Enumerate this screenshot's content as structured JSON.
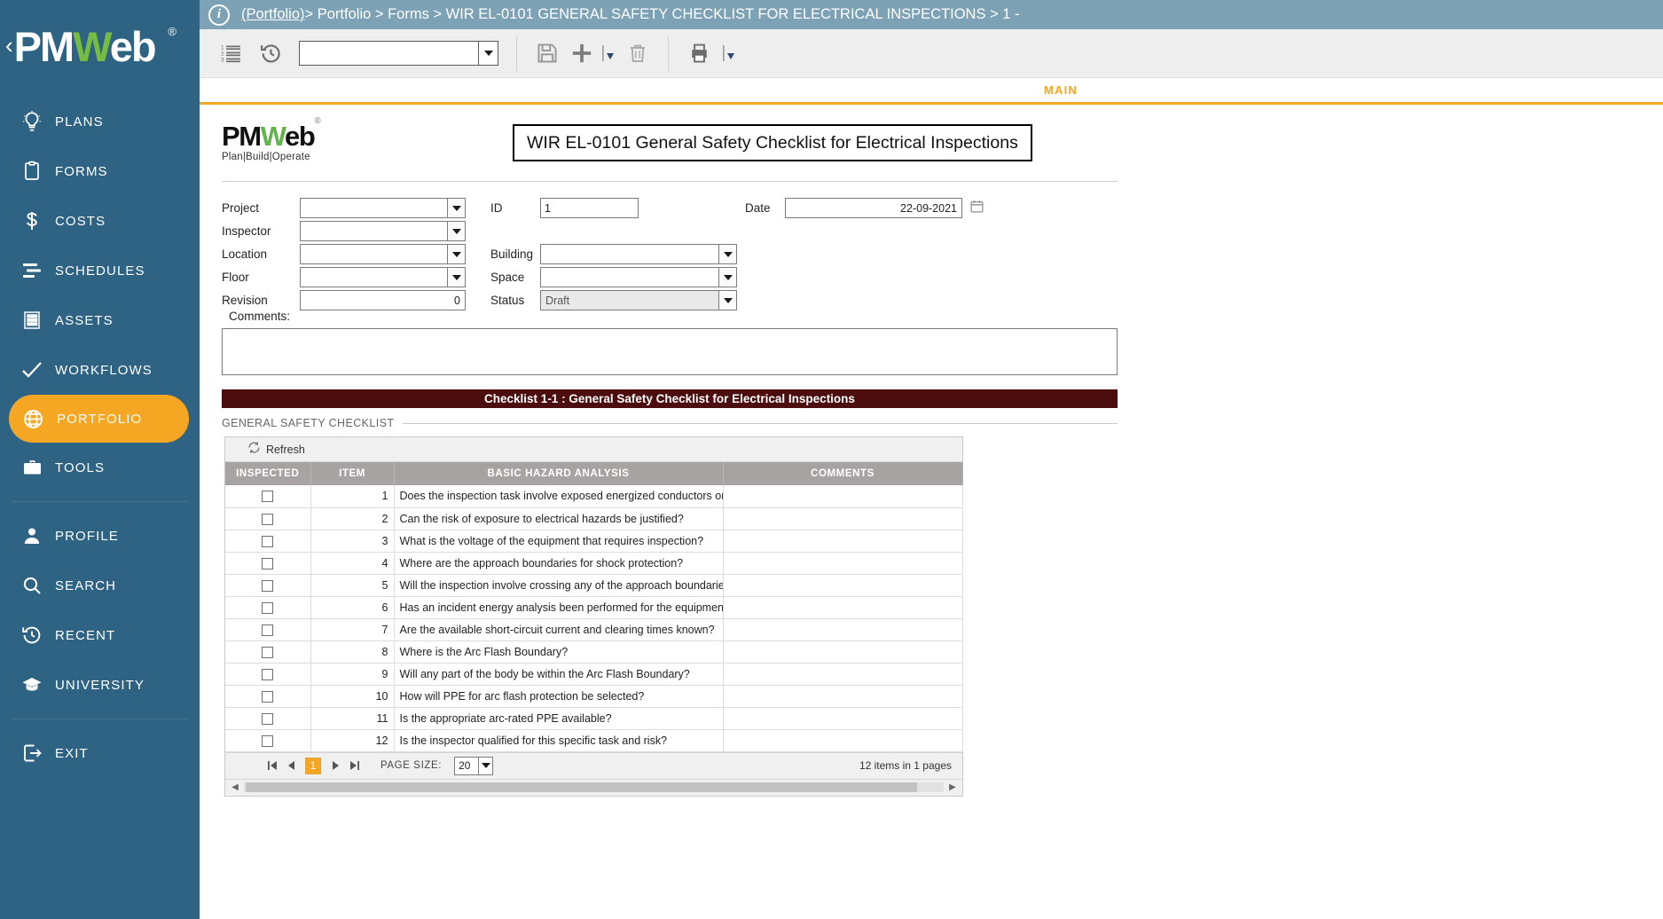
{
  "sidebar": {
    "brand": {
      "chevron": "‹",
      "name_pm": "PM",
      "name_w": "W",
      "name_eb": "eb",
      "reg": "®"
    },
    "items": [
      {
        "label": "PLANS",
        "icon": "lightbulb-icon"
      },
      {
        "label": "FORMS",
        "icon": "clipboard-icon"
      },
      {
        "label": "COSTS",
        "icon": "dollar-icon"
      },
      {
        "label": "SCHEDULES",
        "icon": "bars-icon"
      },
      {
        "label": "ASSETS",
        "icon": "building-icon"
      },
      {
        "label": "WORKFLOWS",
        "icon": "checkmark-icon"
      },
      {
        "label": "PORTFOLIO",
        "icon": "globe-icon"
      },
      {
        "label": "TOOLS",
        "icon": "briefcase-icon"
      },
      {
        "label": "PROFILE",
        "icon": "person-icon"
      },
      {
        "label": "SEARCH",
        "icon": "search-icon"
      },
      {
        "label": "RECENT",
        "icon": "history-icon"
      },
      {
        "label": "UNIVERSITY",
        "icon": "graduation-cap-icon"
      },
      {
        "label": "EXIT",
        "icon": "exit-icon"
      }
    ],
    "active_label": "PORTFOLIO"
  },
  "breadcrumb": {
    "info_glyph": "i",
    "root": "(Portfolio)",
    "trail": " > Portfolio > Forms > WIR EL-0101 GENERAL SAFETY CHECKLIST FOR ELECTRICAL INSPECTIONS > 1 -"
  },
  "toolbar": {
    "list_icon": "numbered-list-icon",
    "history_icon": "history-clock-icon",
    "select_value": "",
    "save_icon": "save-floppy-icon",
    "add_icon": "add-plus-icon",
    "delete_icon": "trash-icon",
    "print_icon": "printer-icon"
  },
  "tabs": {
    "main": "MAIN"
  },
  "form": {
    "logo_pm": "PM",
    "logo_w": "W",
    "logo_eb": "eb",
    "logo_tagline": "Plan|Build|Operate",
    "title": "WIR EL-0101 General Safety Checklist for Electrical Inspections",
    "fields": {
      "project_label": "Project",
      "project_value": "",
      "inspector_label": "Inspector",
      "inspector_value": "",
      "location_label": "Location",
      "location_value": "",
      "floor_label": "Floor",
      "floor_value": "",
      "revision_label": "Revision",
      "revision_value": "0",
      "id_label": "ID",
      "id_value": "1",
      "building_label": "Building",
      "building_value": "",
      "space_label": "Space",
      "space_value": "",
      "status_label": "Status",
      "status_value": "Draft",
      "date_label": "Date",
      "date_value": "22-09-2021",
      "calendar_icon": "calendar-icon"
    },
    "comments_label": "Comments:",
    "comments_value": ""
  },
  "checklist": {
    "banner": "Checklist 1-1 : General Safety Checklist for Electrical Inspections",
    "section_legend": "GENERAL SAFETY CHECKLIST",
    "refresh_label": "Refresh",
    "refresh_icon": "refresh-icon",
    "columns": [
      "INSPECTED",
      "ITEM",
      "BASIC HAZARD ANALYSIS",
      "COMMENTS"
    ],
    "rows": [
      {
        "checked": false,
        "item": "1",
        "analysis": "Does the inspection task involve exposed energized conductors or",
        "comments": ""
      },
      {
        "checked": false,
        "item": "2",
        "analysis": "Can the risk of exposure to electrical hazards be justified?",
        "comments": ""
      },
      {
        "checked": false,
        "item": "3",
        "analysis": "What is the voltage of the equipment that requires inspection?",
        "comments": ""
      },
      {
        "checked": false,
        "item": "4",
        "analysis": "Where are the approach boundaries for shock protection?",
        "comments": ""
      },
      {
        "checked": false,
        "item": "5",
        "analysis": "Will the inspection involve crossing any of the approach boundarie",
        "comments": ""
      },
      {
        "checked": false,
        "item": "6",
        "analysis": "Has an incident energy analysis been performed for the equipment",
        "comments": ""
      },
      {
        "checked": false,
        "item": "7",
        "analysis": "Are the available short-circuit current and clearing times known?",
        "comments": ""
      },
      {
        "checked": false,
        "item": "8",
        "analysis": "Where is the Arc Flash Boundary?",
        "comments": ""
      },
      {
        "checked": false,
        "item": "9",
        "analysis": "Will any part of the body be within the Arc Flash Boundary?",
        "comments": ""
      },
      {
        "checked": false,
        "item": "10",
        "analysis": "How will PPE for arc flash protection be selected?",
        "comments": ""
      },
      {
        "checked": false,
        "item": "11",
        "analysis": "Is the appropriate arc-rated PPE available?",
        "comments": ""
      },
      {
        "checked": false,
        "item": "12",
        "analysis": "Is the inspector qualified for this specific task and risk?",
        "comments": ""
      }
    ],
    "pager": {
      "first_icon": "page-first-icon",
      "prev_icon": "page-prev-icon",
      "next_icon": "page-next-icon",
      "last_icon": "page-last-icon",
      "current_page": "1",
      "page_size_label": "PAGE SIZE:",
      "page_size_value": "20",
      "count_text": "12 items in 1 pages"
    }
  },
  "colors": {
    "sidebar_bg": "#2e6384",
    "accent_orange": "#f5a623",
    "crumb_bg": "#7da2b5",
    "banner_maroon": "#4b0d0d",
    "grid_header": "#a8a3a3",
    "logo_green": "#76bc43"
  }
}
